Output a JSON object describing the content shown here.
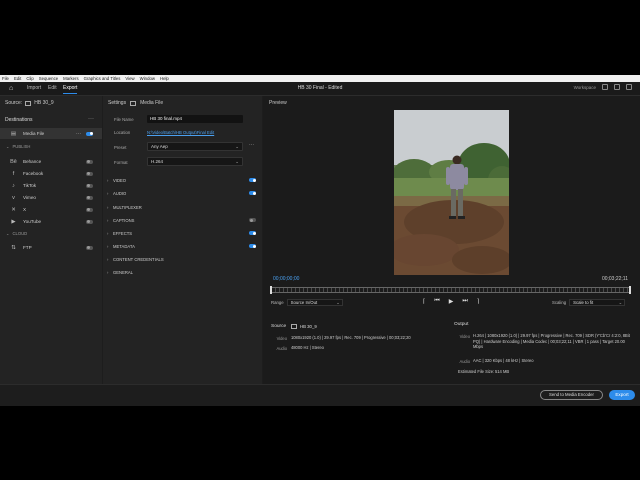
{
  "menu": [
    "File",
    "Edit",
    "Clip",
    "Sequence",
    "Markers",
    "Graphics and Titles",
    "View",
    "Window",
    "Help"
  ],
  "nav": {
    "import": "Import",
    "edit": "Edit",
    "export": "Export"
  },
  "document_title": "HB 30 Final - Edited",
  "top_right_label": "Workspace",
  "source": {
    "label": "Source:",
    "name": "HB 30_9"
  },
  "destinations": {
    "title": "Destinations",
    "media_file": "Media File",
    "publish_label": "PUBLISH",
    "publish": [
      "Behance",
      "Facebook",
      "TikTok",
      "Vimeo",
      "X",
      "YouTube"
    ],
    "cloud_label": "CLOUD",
    "cloud": [
      "FTP"
    ]
  },
  "settings": {
    "title": "Settings",
    "media_label": "Media File",
    "file_name_label": "File Name",
    "file_name": "HB 30 final.mp4",
    "location_label": "Location",
    "location": "N:\\Video\\Batch\\HB Output\\Final Edit",
    "preset_label": "Preset",
    "preset": "Any Aep",
    "format_label": "Format",
    "format": "H.264",
    "sections": [
      "VIDEO",
      "AUDIO",
      "MULTIPLEXER",
      "CAPTIONS",
      "EFFECTS",
      "METADATA",
      "CONTENT CREDENTIALS",
      "GENERAL"
    ],
    "section_toggles": [
      true,
      true,
      null,
      false,
      true,
      true,
      null,
      null
    ]
  },
  "preview": {
    "title": "Preview",
    "timecode_in": "00;00;00;00",
    "timecode_out": "00;03;22;11",
    "range_label": "Range",
    "range_value": "Source In/Out",
    "scaling_label": "Scaling",
    "scaling_value": "Scale to fit"
  },
  "info": {
    "source_label": "Source",
    "source_name": "HB 30_9",
    "source_video_label": "Video",
    "source_video": "1080x1920 (1.0)  |  29.97 fps  |  Rec. 709  |  Progressive  |  00;03;22;20",
    "source_audio_label": "Audio",
    "source_audio": "48000 Hz  |  Stereo",
    "output_label": "Output",
    "output_video_label": "Video",
    "output_video": "H.264  |  1080x1920 (1.0)  |  29.97 fps  |  Progressive  |  Rec. 709  |  SDR (Y'Cb'Cr 4:2:0, 8Bit PQ)  |  Hardware Encoding  |  Media Codec  |  00;03;22;11  |  VBR  |  1 pass  |  Target 20.00 Mbps",
    "output_audio_label": "Audio",
    "output_audio": "AAC  |  320 Kbps  |  48 kHz  |  Stereo",
    "file_size_label": "Estimated File Size:",
    "file_size": "514 MB"
  },
  "footer": {
    "send_label": "Send to Media Encoder",
    "export_label": "Export"
  },
  "colors": {
    "accent": "#2d8ceb",
    "panel": "#232323",
    "background": "#1d1d1d"
  }
}
